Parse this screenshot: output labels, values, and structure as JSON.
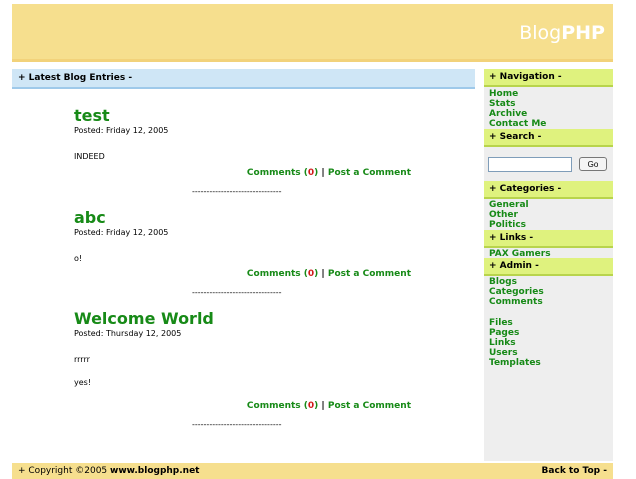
{
  "header": {
    "brand_light": "Blog",
    "brand_bold": "PHP"
  },
  "topbar": {
    "label": "+  Latest Blog Entries  -"
  },
  "entries": [
    {
      "title": "test",
      "posted": "Posted: Friday 12, 2005",
      "body": [
        "INDEED"
      ],
      "comments_label": "Comments (",
      "comments_count": "0",
      "comments_close": ")",
      "pipe": "|",
      "post_comment": "Post a Comment",
      "separator": "-------------------------------"
    },
    {
      "title": "abc",
      "posted": "Posted: Friday 12, 2005",
      "body": [
        "o!"
      ],
      "comments_label": "Comments (",
      "comments_count": "0",
      "comments_close": ")",
      "pipe": "|",
      "post_comment": "Post a Comment",
      "separator": "-------------------------------"
    },
    {
      "title": "Welcome World",
      "posted": "Posted: Thursday 12, 2005",
      "body": [
        "rrrrr",
        "yes!"
      ],
      "comments_label": "Comments (",
      "comments_count": "0",
      "comments_close": ")",
      "pipe": "|",
      "post_comment": "Post a Comment",
      "separator": "-------------------------------"
    }
  ],
  "sidebar": {
    "navigation": {
      "title": "+  Navigation  -",
      "items": [
        "Home",
        "Stats",
        "Archive",
        "Contact Me"
      ]
    },
    "search": {
      "title": "+  Search  -",
      "value": "",
      "button": "Go"
    },
    "categories": {
      "title": "+  Categories  -",
      "items": [
        "General",
        "Other",
        "Politics"
      ]
    },
    "links": {
      "title": "+  Links  -",
      "items": [
        "PAX Gamers"
      ]
    },
    "admin": {
      "title": "+  Admin  -",
      "items": [
        "Blogs",
        "Categories",
        "Comments",
        "Files",
        "Pages",
        "Links",
        "Users",
        "Templates"
      ]
    }
  },
  "footer": {
    "copyright_prefix": "+  Copyright ©2005 ",
    "site": "www.blogphp.net",
    "back_to_top": "Back to Top  -"
  },
  "colors": {
    "header": "#f6df8e",
    "topbar": "#cfe6f6",
    "sidebar_head": "#dff27e",
    "link_green": "#178a17",
    "count_red": "#d01a1a"
  }
}
